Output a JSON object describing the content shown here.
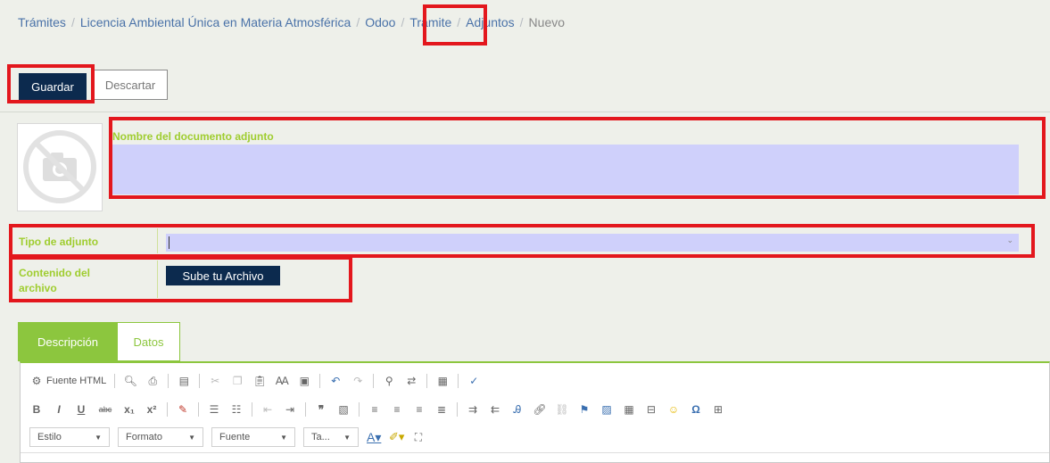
{
  "breadcrumb": {
    "items": [
      "Trámites",
      "Licencia Ambiental Única en Materia Atmosférica",
      "Odoo",
      "Trámite",
      "Adjuntos"
    ],
    "current": "Nuevo",
    "separator": "/"
  },
  "toolbar": {
    "save_label": "Guardar",
    "discard_label": "Descartar"
  },
  "form": {
    "name_label": "Nombre del documento adjunto",
    "name_value": "",
    "type_label": "Tipo de adjunto",
    "type_value": "",
    "content_label_line1": "Contenido del",
    "content_label_line2": "archivo",
    "upload_label": "Sube tu Archivo"
  },
  "tabs": [
    {
      "label": "Descripción",
      "active": true
    },
    {
      "label": "Datos",
      "active": false
    }
  ],
  "editor": {
    "html_source_label": "Fuente HTML",
    "format_row_b": "B",
    "format_row_i": "I",
    "format_row_u": "U",
    "format_row_strike": "abc",
    "format_row_sub": "x₁",
    "format_row_sup": "x²",
    "combos": [
      {
        "label": "Estilo"
      },
      {
        "label": "Formato"
      },
      {
        "label": "Fuente"
      },
      {
        "label": "Ta..."
      }
    ]
  },
  "colors": {
    "accent_green": "#8cc63e",
    "navy": "#0c2a4e",
    "field_purple": "#cfd0fb",
    "highlight_red": "#e3171d"
  }
}
